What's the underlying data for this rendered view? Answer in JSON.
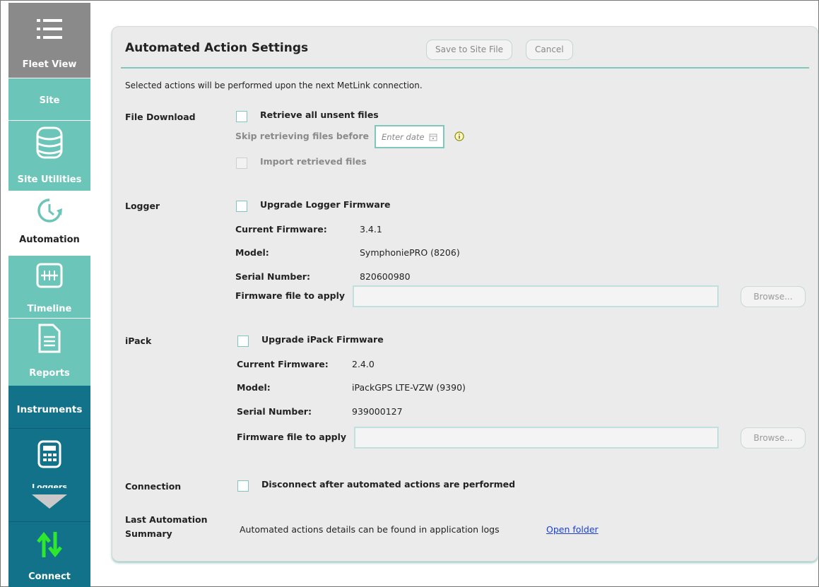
{
  "sidebar": {
    "fleet_view": "Fleet View",
    "site": "Site",
    "site_utilities": "Site Utilities",
    "automation": "Automation",
    "timeline": "Timeline",
    "reports": "Reports",
    "instruments": "Instruments",
    "loggers": "Loggers",
    "connect": "Connect"
  },
  "header": {
    "title": "Automated Action Settings",
    "save_label": "Save to Site File",
    "cancel_label": "Cancel"
  },
  "intro": "Selected actions will be performed upon the next MetLink connection.",
  "file_download": {
    "section": "File Download",
    "retrieve_label": "Retrieve all unsent files",
    "skip_label": "Skip retrieving files before",
    "date_placeholder": "Enter date",
    "import_label": "Import retrieved files"
  },
  "logger": {
    "section": "Logger",
    "upgrade_label": "Upgrade Logger Firmware",
    "fw_label": "Current Firmware:",
    "fw_value": "3.4.1",
    "model_label": "Model:",
    "model_value": "SymphoniePRO (8206)",
    "serial_label": "Serial Number:",
    "serial_value": "820600980",
    "file_label": "Firmware file to apply",
    "browse_label": "Browse..."
  },
  "ipack": {
    "section": "iPack",
    "upgrade_label": "Upgrade iPack Firmware",
    "fw_label": "Current Firmware:",
    "fw_value": "2.4.0",
    "model_label": "Model:",
    "model_value": "iPackGPS LTE-VZW (9390)",
    "serial_label": "Serial Number:",
    "serial_value": "939000127",
    "file_label": "Firmware file to apply",
    "browse_label": "Browse..."
  },
  "connection": {
    "section": "Connection",
    "disconnect_label": "Disconnect after automated actions are performed"
  },
  "summary": {
    "section_line1": "Last Automation",
    "section_line2": "Summary",
    "text": "Automated actions details can be found in application logs",
    "link": "Open folder"
  },
  "colors": {
    "teal_light": "#6cc5b9",
    "teal_dark": "#12728a",
    "grey_nav": "#8a8a8a",
    "accent": "#7fc7bd",
    "link": "#1a3fd9",
    "connect_arrows": "#2ee82e"
  },
  "icons": [
    "menu-icon",
    "database-icon",
    "clock-refresh-icon",
    "timeline-icon",
    "document-icon",
    "calculator-icon",
    "chevron-down-icon",
    "up-down-arrows-icon",
    "calendar-icon",
    "info-icon"
  ]
}
